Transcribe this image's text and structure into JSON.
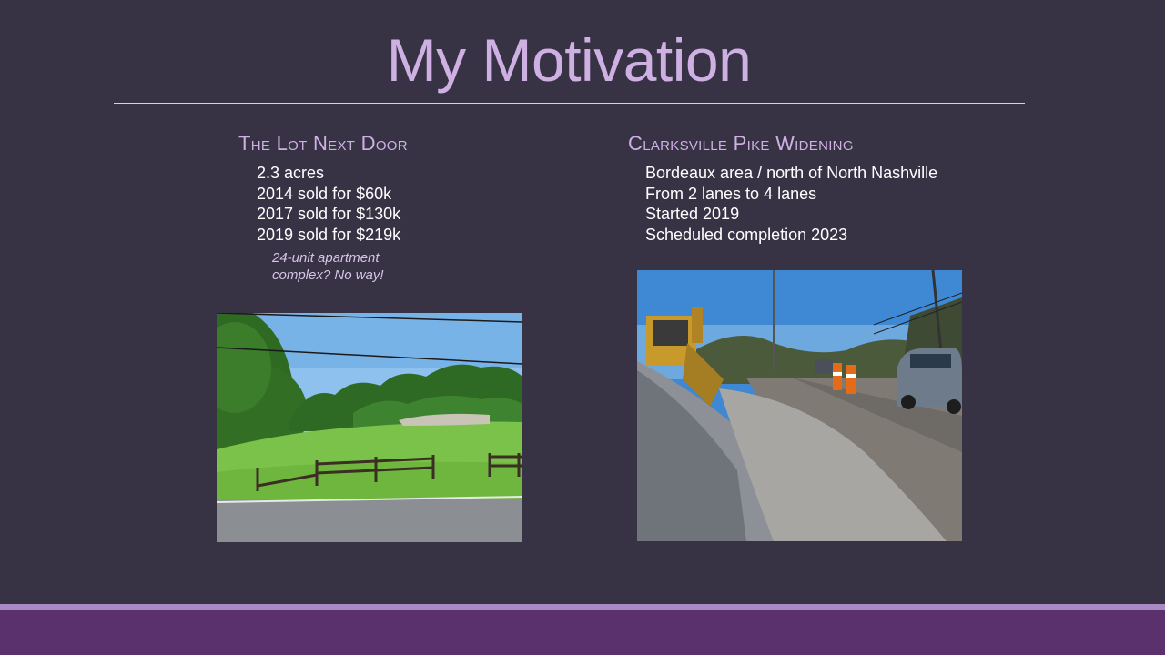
{
  "slide": {
    "title": "My Motivation"
  },
  "left": {
    "heading": "The Lot Next Door",
    "bullets": [
      "2.3 acres",
      "2014 sold for $60k",
      "2017 sold for $130k",
      "2019 sold for $219k"
    ],
    "note_line1": "24-unit apartment",
    "note_line2": "complex? No way!"
  },
  "right": {
    "heading": "Clarksville Pike Widening",
    "bullets": [
      "Bordeaux area / north of North Nashville",
      "From 2 lanes to 4 lanes",
      "Started 2019",
      "Scheduled completion 2023"
    ]
  },
  "colors": {
    "background": "#373345",
    "title": "#cfb0e3",
    "accent_bar": "#a98ac4",
    "footer_band": "#5a316c"
  }
}
